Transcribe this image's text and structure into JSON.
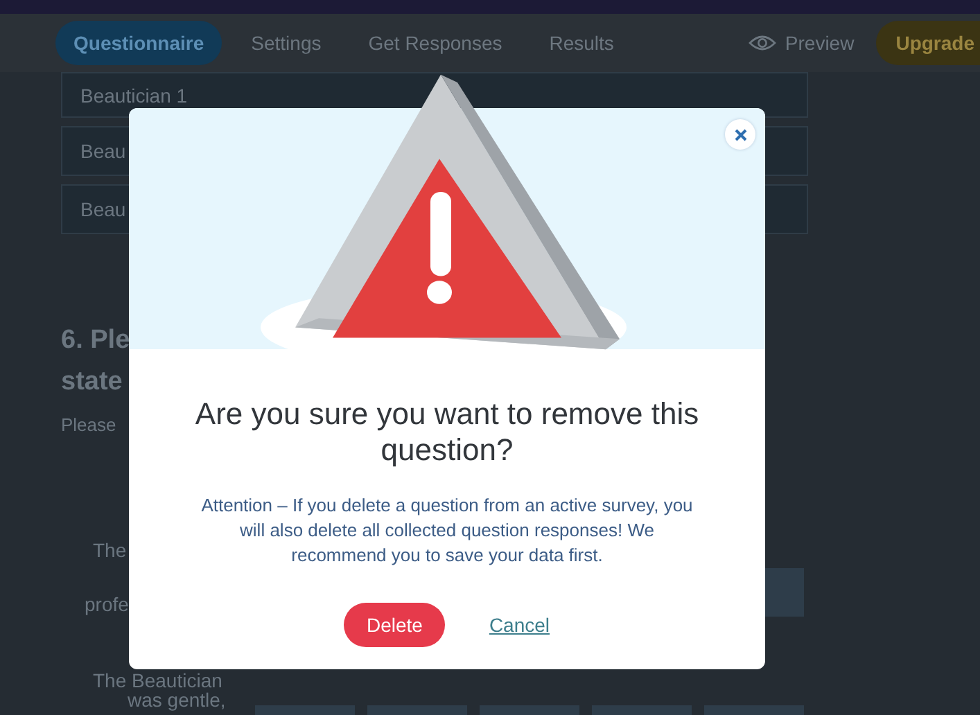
{
  "nav": {
    "tabs": [
      {
        "label": "Questionnaire",
        "selected": true
      },
      {
        "label": "Settings",
        "selected": false
      },
      {
        "label": "Get Responses",
        "selected": false
      },
      {
        "label": "Results",
        "selected": false
      }
    ],
    "preview": "Preview",
    "upgrade": "Upgrade"
  },
  "background": {
    "options": [
      "Beautician 1",
      "Beau",
      "Beau"
    ],
    "question_lines": [
      "6. Ple",
      "state"
    ],
    "hint": "Please",
    "row_labels": [
      "The",
      "profe",
      "The Beautician",
      "was gentle,"
    ]
  },
  "dialog": {
    "title": "Are you sure you want to remove this question?",
    "message": "Attention – If you delete a question from an active survey, you will also delete all collected question responses! We recommend you to save your data first.",
    "delete_button": "Delete",
    "cancel_link": "Cancel"
  }
}
